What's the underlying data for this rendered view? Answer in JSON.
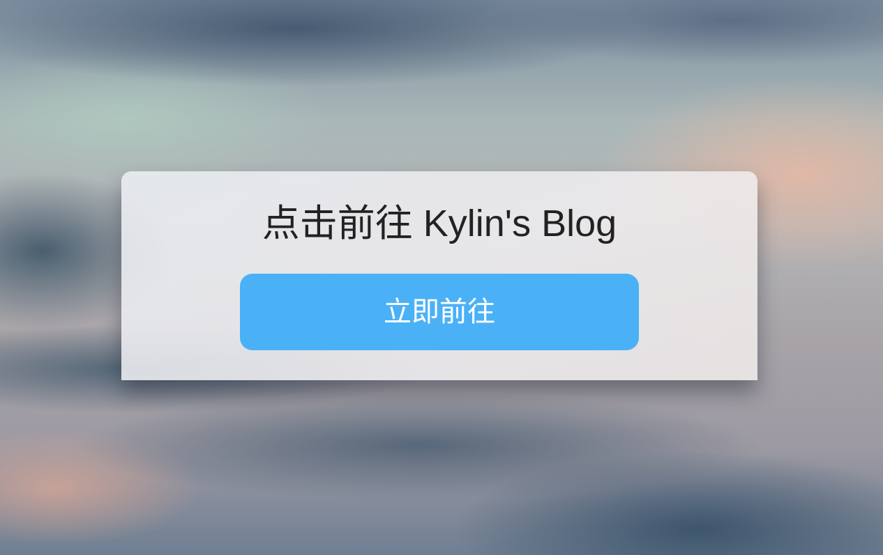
{
  "card": {
    "title": "点击前往 Kylin's Blog",
    "button_label": "立即前往"
  },
  "colors": {
    "button_background": "#4bb1f7",
    "button_text": "#ffffff",
    "title_text": "#222222"
  }
}
